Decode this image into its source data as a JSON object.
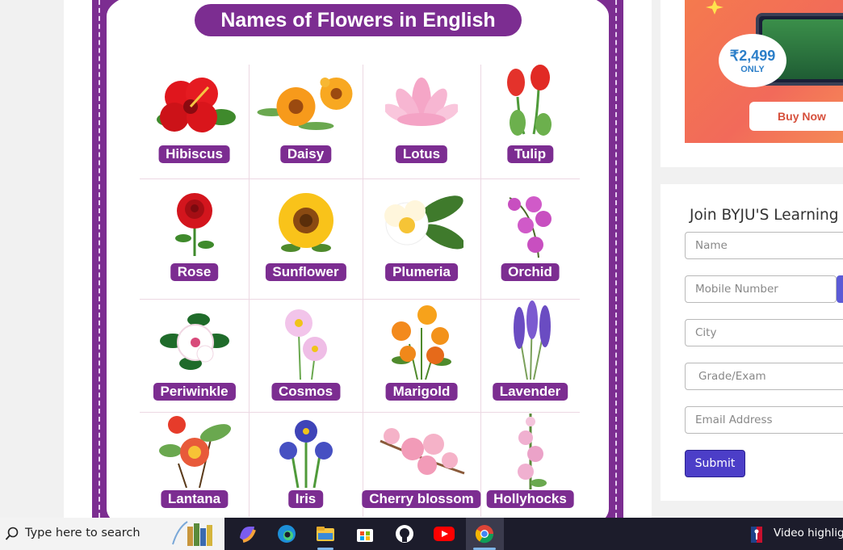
{
  "poster": {
    "title": "Names of Flowers in English",
    "flowers": [
      {
        "name": "Hibiscus"
      },
      {
        "name": "Daisy"
      },
      {
        "name": "Lotus"
      },
      {
        "name": "Tulip"
      },
      {
        "name": "Rose"
      },
      {
        "name": "Sunflower"
      },
      {
        "name": "Plumeria"
      },
      {
        "name": "Orchid"
      },
      {
        "name": "Periwinkle"
      },
      {
        "name": "Cosmos"
      },
      {
        "name": "Marigold"
      },
      {
        "name": "Lavender"
      },
      {
        "name": "Lantana"
      },
      {
        "name": "Iris"
      },
      {
        "name": "Cherry blossom"
      },
      {
        "name": "Hollyhocks"
      }
    ]
  },
  "ad": {
    "price": "₹2,499",
    "price_note": "ONLY",
    "buy_label": "Buy Now"
  },
  "form": {
    "title": "Join BYJU'S Learning",
    "name_placeholder": "Name",
    "mobile_placeholder": "Mobile Number",
    "city_placeholder": "City",
    "grade_placeholder": "Grade/Exam",
    "email_placeholder": "Email Address",
    "submit_label": "Submit"
  },
  "taskbar": {
    "search_placeholder": "Type here to search",
    "apps": [
      "copilot-icon",
      "edge-icon",
      "file-explorer-icon",
      "microsoft-store-icon",
      "github-icon",
      "youtube-icon",
      "chrome-icon"
    ],
    "news_text": "Video highlig"
  },
  "colors": {
    "poster_purple": "#7c2d91",
    "submit_blue": "#4c3ec8",
    "taskbar": "#1c1c2b"
  }
}
